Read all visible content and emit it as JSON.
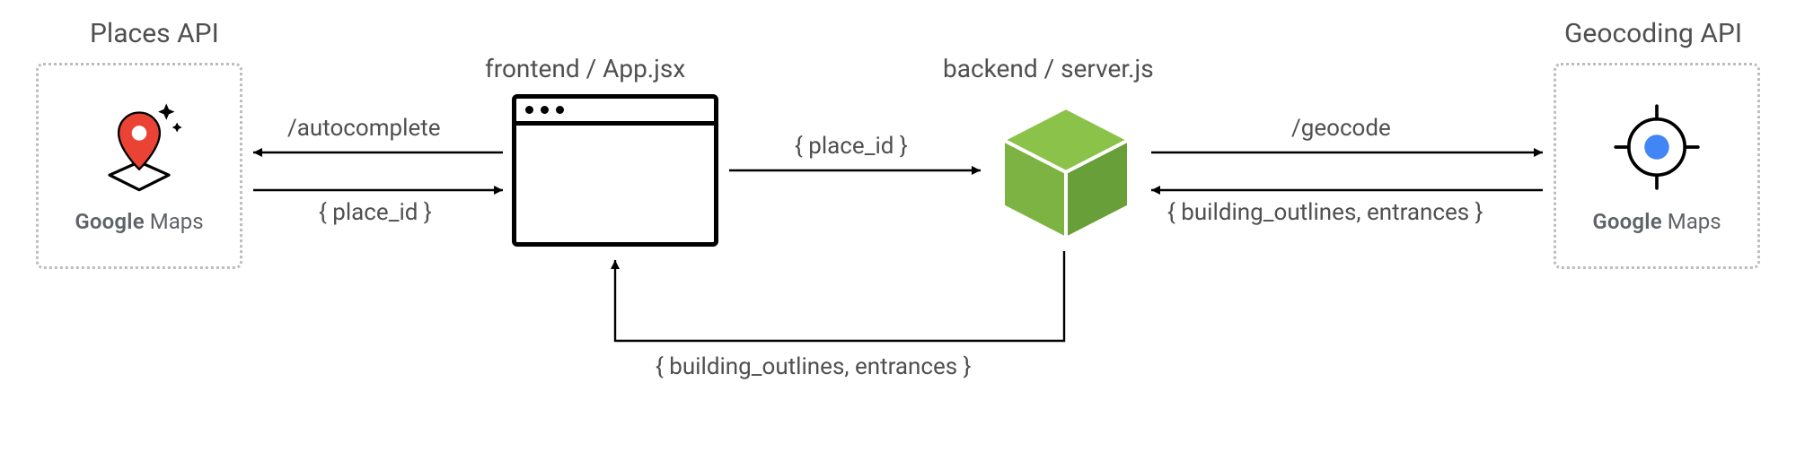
{
  "diagram": {
    "left_api": {
      "title": "Places API",
      "brand_google": "Google",
      "brand_maps": " Maps"
    },
    "right_api": {
      "title": "Geocoding API",
      "brand_google": "Google",
      "brand_maps": " Maps"
    },
    "frontend": {
      "label": "frontend / App.jsx"
    },
    "backend": {
      "label": "backend / server.js"
    },
    "edges": {
      "places_request": "/autocomplete",
      "places_response": "{ place_id }",
      "fe_to_be": "{ place_id }",
      "be_to_fe": "{ building_outlines, entrances }",
      "geocode_request": "/geocode",
      "geocode_response": "{ building_outlines, entrances }"
    }
  }
}
